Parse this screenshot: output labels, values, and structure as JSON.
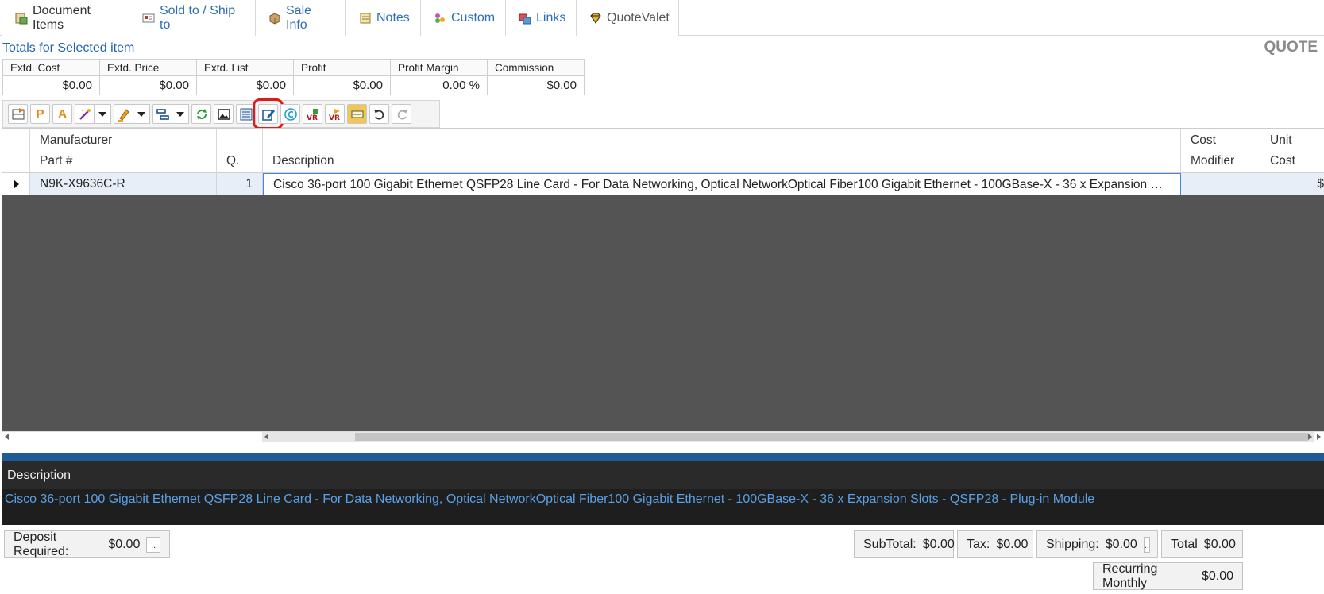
{
  "tabs": [
    {
      "label": "Document Items",
      "icon": "document-items-icon",
      "active": true
    },
    {
      "label": "Sold to / Ship to",
      "icon": "address-card-icon"
    },
    {
      "label": "Sale Info",
      "icon": "package-icon"
    },
    {
      "label": "Notes",
      "icon": "note-icon"
    },
    {
      "label": "Custom",
      "icon": "custom-icon"
    },
    {
      "label": "Links",
      "icon": "links-icon"
    },
    {
      "label": "QuoteValet",
      "icon": "quotevalet-icon"
    }
  ],
  "totals": {
    "label": "Totals for Selected item",
    "headers": [
      "Extd. Cost",
      "Extd. Price",
      "Extd. List",
      "Profit",
      "Profit Margin",
      "Commission"
    ],
    "values": [
      "$0.00",
      "$0.00",
      "$0.00",
      "$0.00",
      "0.00 %",
      "$0.00"
    ]
  },
  "doc_type": "QUOTE",
  "toolbar": {
    "p_label": "P",
    "a_label": "A"
  },
  "grid": {
    "headers": {
      "manufacturer": "Manufacturer",
      "part": "Part #",
      "qty": "Q.",
      "description": "Description",
      "cost_mod_1": "Cost",
      "cost_mod_2": "Modifier",
      "unit_cost_1": "Unit",
      "unit_cost_2": "Cost"
    },
    "rows": [
      {
        "part": "N9K-X9636C-R",
        "qty": "1",
        "description": "Cisco 36-port 100 Gigabit Ethernet QSFP28 Line Card - For Data Networking, Optical NetworkOptical Fiber100 Gigabit Ethernet - 100GBase-X - 36 x Expansion …",
        "unit_cost_partial": "$"
      }
    ]
  },
  "description_panel": {
    "title": "Description",
    "text": "Cisco 36-port 100 Gigabit Ethernet QSFP28 Line Card - For Data Networking, Optical NetworkOptical Fiber100 Gigabit Ethernet - 100GBase-X - 36 x Expansion Slots - QSFP28 - Plug-in Module"
  },
  "footer": {
    "deposit_label": "Deposit Required:",
    "deposit_value": "$0.00",
    "subtotal_label": "SubTotal:",
    "subtotal_value": "$0.00",
    "tax_label": "Tax:",
    "tax_value": "$0.00",
    "shipping_label": "Shipping:",
    "shipping_value": "$0.00",
    "total_label": "Total",
    "total_value": "$0.00",
    "recurring_label": "Recurring Monthly",
    "recurring_value": "$0.00",
    "dots": ".."
  }
}
